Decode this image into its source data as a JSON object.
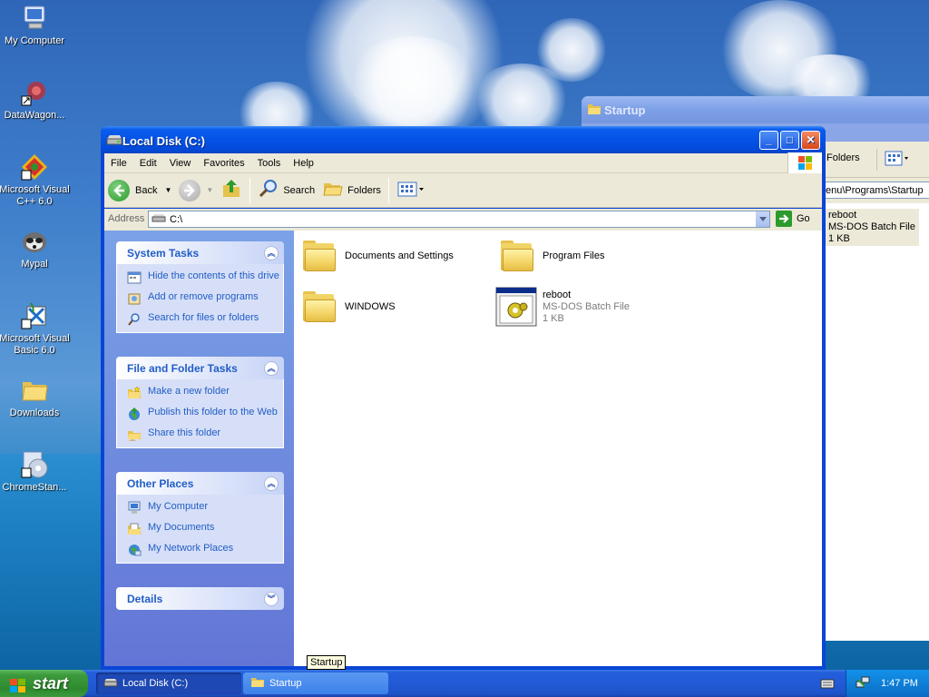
{
  "desktop": {
    "icons": [
      {
        "label": "My Computer"
      },
      {
        "label": "DataWagon..."
      },
      {
        "label": "Microsoft Visual C++ 6.0"
      },
      {
        "label": "Mypal"
      },
      {
        "label": "Microsoft Visual Basic 6.0"
      },
      {
        "label": "Downloads"
      },
      {
        "label": "ChromeStan..."
      }
    ]
  },
  "startup_window": {
    "title": "Startup",
    "folders_label": "Folders",
    "address": "enu\\Programs\\Startup",
    "file": {
      "name": "reboot",
      "type": "MS-DOS Batch File",
      "size": "1 KB"
    }
  },
  "main_window": {
    "title": "Local Disk (C:)",
    "menu": [
      "File",
      "Edit",
      "View",
      "Favorites",
      "Tools",
      "Help"
    ],
    "toolbar": {
      "back": "Back",
      "search": "Search",
      "folders": "Folders"
    },
    "address": {
      "label": "Address",
      "value": "C:\\",
      "go": "Go"
    },
    "task_pane": {
      "system_tasks": {
        "title": "System Tasks",
        "items": [
          "Hide the contents of this drive",
          "Add or remove programs",
          "Search for files or folders"
        ]
      },
      "file_folder_tasks": {
        "title": "File and Folder Tasks",
        "items": [
          "Make a new folder",
          "Publish this folder to the Web",
          "Share this folder"
        ]
      },
      "other_places": {
        "title": "Other Places",
        "items": [
          "My Computer",
          "My Documents",
          "My Network Places"
        ]
      },
      "details": {
        "title": "Details"
      }
    },
    "items": [
      {
        "name": "Documents and Settings"
      },
      {
        "name": "Program Files"
      },
      {
        "name": "WINDOWS"
      },
      {
        "name": "reboot",
        "type": "MS-DOS Batch File",
        "size": "1 KB"
      }
    ]
  },
  "tooltip": "Startup",
  "taskbar": {
    "start": "start",
    "tasks": [
      {
        "label": "Local Disk (C:)"
      },
      {
        "label": "Startup"
      }
    ],
    "clock": "1:47 PM"
  },
  "colors": {
    "title_active": "#0553e6",
    "task_link": "#215dc6",
    "taskbar": "#245edb"
  }
}
